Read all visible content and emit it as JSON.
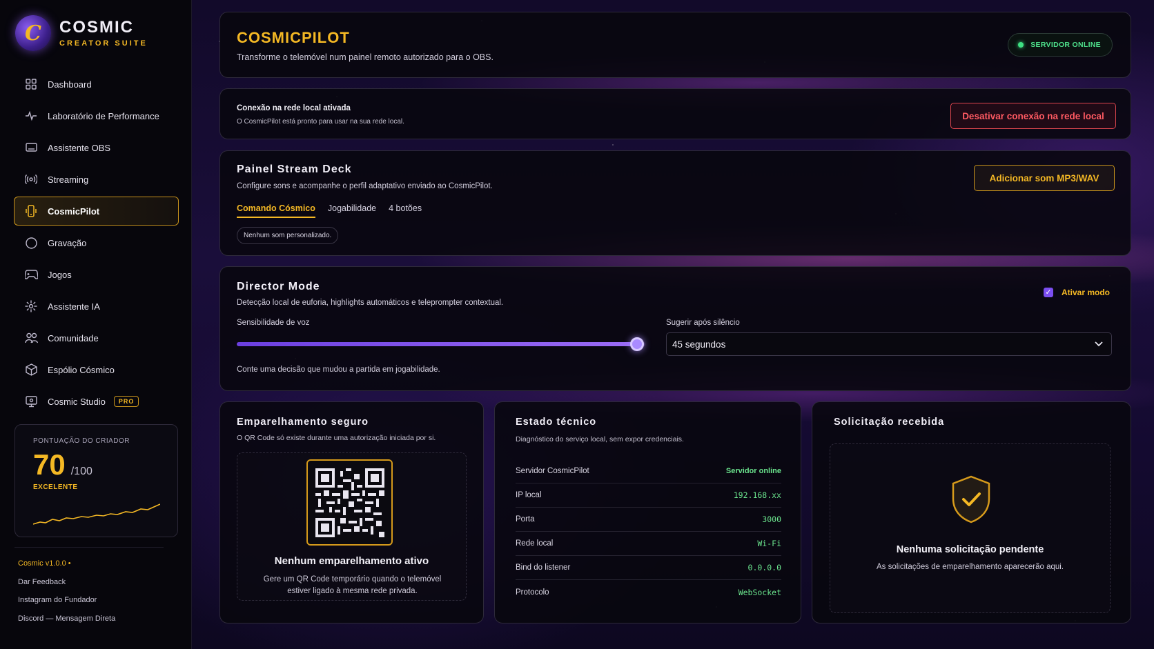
{
  "brand": {
    "title": "COSMIC",
    "subtitle": "CREATOR SUITE",
    "logo_icon": "cosmic-c-logo"
  },
  "sidebar": {
    "items": [
      {
        "label": "Dashboard",
        "icon": "grid-icon"
      },
      {
        "label": "Laboratório de Performance",
        "icon": "pulse-icon"
      },
      {
        "label": "Assistente OBS",
        "icon": "monitor-icon"
      },
      {
        "label": "Streaming",
        "icon": "broadcast-icon"
      },
      {
        "label": "CosmicPilot",
        "icon": "phone-icon",
        "active": true
      },
      {
        "label": "Gravação",
        "icon": "record-icon"
      },
      {
        "label": "Jogos",
        "icon": "gamepad-icon"
      },
      {
        "label": "Assistente IA",
        "icon": "sparkle-icon"
      },
      {
        "label": "Comunidade",
        "icon": "users-icon"
      },
      {
        "label": "Espólio Cósmico",
        "icon": "cube-icon"
      },
      {
        "label": "Cosmic Studio",
        "icon": "studio-icon",
        "badge": "PRO"
      }
    ],
    "score": {
      "label": "PONTUAÇÃO DO CRIADOR",
      "value": "70",
      "max": "/100",
      "grade": "EXCELENTE"
    },
    "footer": {
      "version": "Cosmic v1.0.0 •",
      "links": [
        "Dar Feedback",
        "Instagram do Fundador",
        "Discord — Mensagem Direta"
      ]
    }
  },
  "header": {
    "title": "COSMICPILOT",
    "subtitle": "Transforme o telemóvel num painel remoto autorizado para o OBS.",
    "status": "SERVIDOR ONLINE"
  },
  "network": {
    "title": "Conexão na rede local ativada",
    "subtitle": "O CosmicPilot está pronto para usar na sua rede local.",
    "button": "Desativar conexão na rede local"
  },
  "deck": {
    "title": "Painel Stream Deck",
    "subtitle": "Configure sons e acompanhe o perfil adaptativo enviado ao CosmicPilot.",
    "button": "Adicionar som MP3/WAV",
    "tabs": [
      "Comando Cósmico",
      "Jogabilidade",
      "4 botões"
    ],
    "empty_chip": "Nenhum som personalizado."
  },
  "director": {
    "title": "Director Mode",
    "subtitle": "Detecção local de euforia, highlights automáticos e teleprompter contextual.",
    "toggle_label": "Ativar modo",
    "toggle_checked": true,
    "sensitivity_label": "Sensibilidade de voz",
    "sensitivity_value": 0.98,
    "silence_label": "Sugerir após silêncio",
    "silence_value": "45 segundos",
    "prompt": "Conte uma decisão que mudou a partida em jogabilidade."
  },
  "pairing": {
    "title": "Emparelhamento seguro",
    "subtitle": "O QR Code só existe durante uma autorização iniciada por si.",
    "empty_title": "Nenhum emparelhamento ativo",
    "empty_text": "Gere um QR Code temporário quando o telemóvel estiver ligado à mesma rede privada."
  },
  "tech": {
    "title": "Estado técnico",
    "subtitle": "Diagnóstico do serviço local, sem expor credenciais.",
    "rows": [
      {
        "key": "Servidor CosmicPilot",
        "value": "Servidor online"
      },
      {
        "key": "IP local",
        "value": "192.168.xx"
      },
      {
        "key": "Porta",
        "value": "3000"
      },
      {
        "key": "Rede local",
        "value": "Wi-Fi"
      },
      {
        "key": "Bind do listener",
        "value": "0.0.0.0"
      },
      {
        "key": "Protocolo",
        "value": "WebSocket"
      }
    ]
  },
  "request": {
    "title": "Solicitação recebida",
    "empty_title": "Nenhuma solicitação pendente",
    "empty_text": "As solicitações de emparelhamento aparecerão aqui."
  },
  "colors": {
    "accent": "#f4b824",
    "success": "#4ee08b",
    "danger": "#ff5a62",
    "violet": "#7b4ef0"
  }
}
